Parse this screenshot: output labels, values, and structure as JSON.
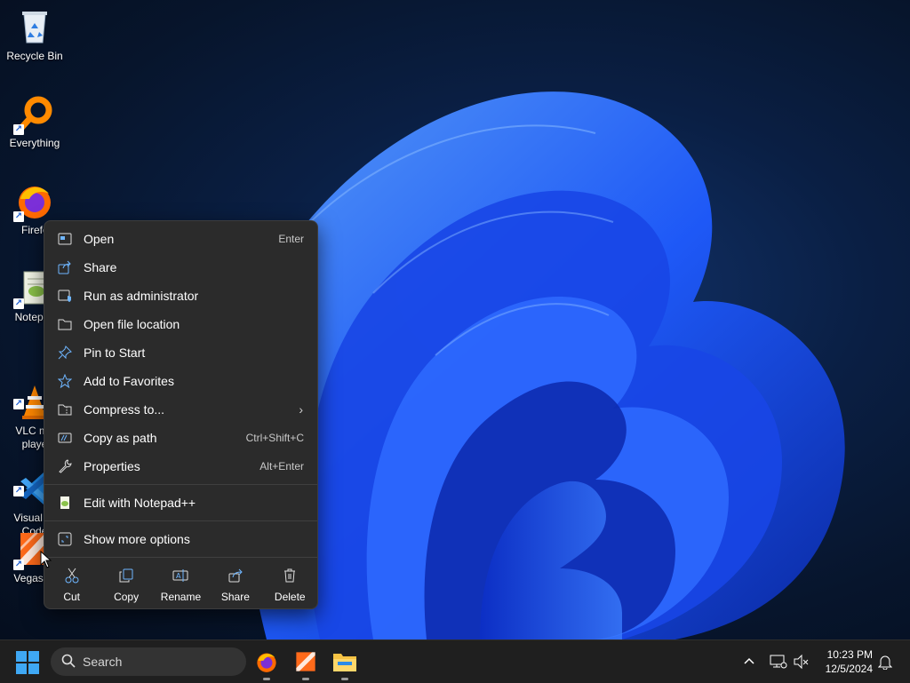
{
  "desktop": {
    "icons": [
      {
        "label": "Recycle Bin",
        "icon": "recycle-bin-icon"
      },
      {
        "label": "Everything",
        "icon": "everything-search-icon"
      },
      {
        "label": "Firefc",
        "icon": "firefox-icon"
      },
      {
        "label": "Notepac",
        "icon": "notepad-plus-plus-icon"
      },
      {
        "label": "VLC me\nplaye",
        "icon": "vlc-cone-icon"
      },
      {
        "label": "Visual St\nCode",
        "icon": "vscode-icon"
      },
      {
        "label": "Vegas Vi",
        "icon": "vegas-video-icon"
      }
    ]
  },
  "context_menu": {
    "items": [
      {
        "label": "Open",
        "shortcut": "Enter",
        "icon": "open-window-icon"
      },
      {
        "label": "Share",
        "shortcut": "",
        "icon": "share-icon"
      },
      {
        "label": "Run as administrator",
        "shortcut": "",
        "icon": "shield-admin-icon"
      },
      {
        "label": "Open file location",
        "shortcut": "",
        "icon": "folder-icon"
      },
      {
        "label": "Pin to Start",
        "shortcut": "",
        "icon": "pin-icon"
      },
      {
        "label": "Add to Favorites",
        "shortcut": "",
        "icon": "star-icon"
      },
      {
        "label": "Compress to...",
        "shortcut": "",
        "icon": "zip-folder-icon",
        "submenu": true
      },
      {
        "label": "Copy as path",
        "shortcut": "Ctrl+Shift+C",
        "icon": "copy-path-icon"
      },
      {
        "label": "Properties",
        "shortcut": "Alt+Enter",
        "icon": "wrench-icon"
      },
      {
        "label": "Edit with Notepad++",
        "shortcut": "",
        "icon": "notepad-plus-plus-icon"
      },
      {
        "label": "Show more options",
        "shortcut": "",
        "icon": "expand-icon"
      }
    ],
    "actions": [
      {
        "label": "Cut",
        "icon": "scissors-icon"
      },
      {
        "label": "Copy",
        "icon": "copy-icon"
      },
      {
        "label": "Rename",
        "icon": "rename-icon"
      },
      {
        "label": "Share",
        "icon": "share-icon"
      },
      {
        "label": "Delete",
        "icon": "trash-icon"
      }
    ]
  },
  "taskbar": {
    "search_placeholder": "Search",
    "pinned_apps": [
      "firefox-icon",
      "vegas-video-icon",
      "file-explorer-icon"
    ],
    "time": "10:23 PM",
    "date": "12/5/2024"
  },
  "colors": {
    "menu_bg": "#2b2b2b",
    "accent": "#3fa8f4",
    "taskbar_bg": "#1f1f1f"
  }
}
